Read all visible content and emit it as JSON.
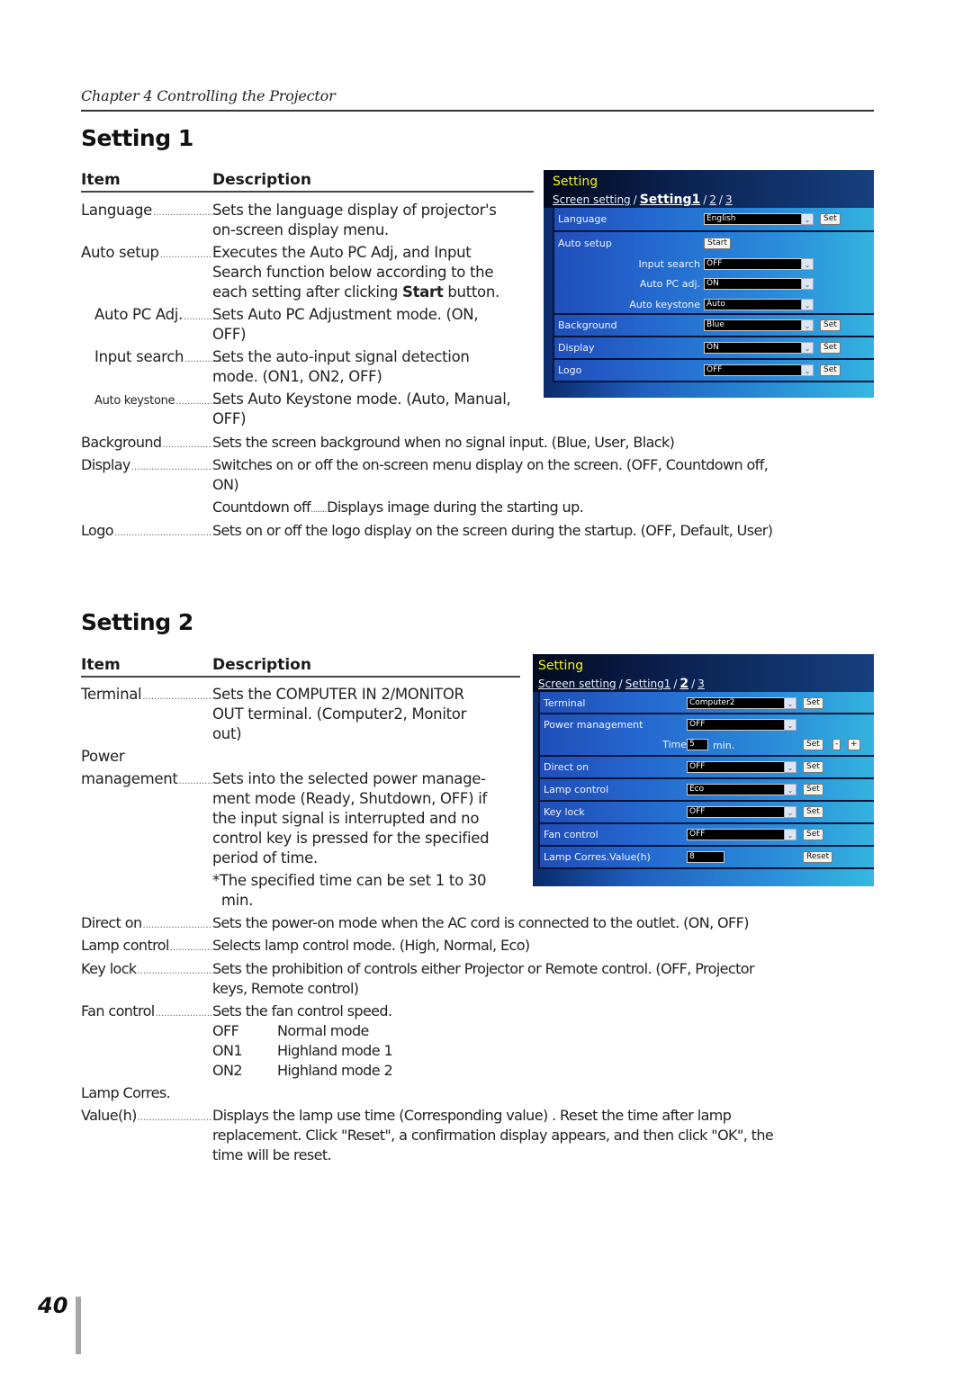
{
  "header": {
    "chapter": "Chapter 4 Controlling the Projector"
  },
  "section1": {
    "title": "Setting 1",
    "col_item": "Item",
    "col_desc": "Description",
    "entries": [
      {
        "item": "Language",
        "desc": [
          "Sets the language display of projector's",
          "on-screen display menu."
        ]
      },
      {
        "item": "Auto setup",
        "desc": [
          "Executes the Auto PC Adj, and Input",
          "Search function below according to the"
        ],
        "desc_last_pre": "each setting after clicking ",
        "desc_last_bold": "Start",
        "desc_last_post": " button."
      },
      {
        "item": "Auto PC Adj.",
        "desc": [
          "Sets Auto PC Adjustment mode. (ON,",
          "OFF)"
        ]
      },
      {
        "item": "Input search",
        "desc": [
          "Sets the auto-input signal detection",
          "mode. (ON1, ON2, OFF)"
        ]
      },
      {
        "item": "Auto keystone",
        "desc": [
          "Sets Auto Keystone mode. (Auto, Manual,",
          "OFF)"
        ]
      },
      {
        "item": "Background",
        "desc": [
          "Sets the screen background  when no signal input. (Blue, User, Black)"
        ]
      },
      {
        "item": "Display",
        "desc": [
          "Switches on or off the on-screen menu display on the screen. (OFF, Countdown off,",
          "ON)"
        ],
        "sub_item": "Countdown off",
        "sub_desc": "Displays image during the starting up."
      },
      {
        "item": "Logo",
        "desc": [
          "Sets on or off the logo display on the screen during the startup. (OFF, Default, User)"
        ]
      }
    ]
  },
  "section2": {
    "title": "Setting 2",
    "col_item": "Item",
    "col_desc": "Description",
    "entries": [
      {
        "item": "Terminal",
        "desc": [
          "Sets the COMPUTER IN 2/MONITOR",
          "OUT terminal. (Computer2, Monitor",
          "out)"
        ]
      },
      {
        "item_line1": "Power",
        "item": "management",
        "desc": [
          "Sets into the selected power manage-",
          "ment mode (Ready, Shutdown, OFF) if",
          "the input signal is interrupted and no",
          "control key is pressed for the specified",
          "period of time."
        ],
        "note": [
          "*The specified time can be set 1 to 30",
          "  min."
        ]
      },
      {
        "item": "Direct on",
        "desc": [
          "Sets the power-on mode when the AC cord is connected to the outlet. (ON, OFF)"
        ]
      },
      {
        "item": "Lamp control",
        "desc": [
          "Selects lamp control mode. (High, Normal, Eco)"
        ]
      },
      {
        "item": "Key lock",
        "desc": [
          "Sets the prohibition of controls either Projector or Remote control. (OFF, Projector",
          "keys, Remote control)"
        ]
      },
      {
        "item": "Fan control",
        "desc": [
          "Sets the fan control speed."
        ],
        "modes": [
          {
            "code": "OFF",
            "label": "Normal mode"
          },
          {
            "code": "ON1",
            "label": "Highland mode 1"
          },
          {
            "code": "ON2",
            "label": "Highland mode 2"
          }
        ]
      },
      {
        "item_line1": "Lamp Corres.",
        "item": "Value(h)",
        "desc": [
          "Displays the lamp use time (Corresponding value) . Reset the time after lamp",
          "replacement. Click \"Reset\", a confirmation display appears, and then click \"OK\", the",
          "time will be reset."
        ]
      }
    ]
  },
  "ui1": {
    "title": "Setting",
    "crumb_screen": "Screen setting",
    "crumb_setting1": "Setting1",
    "crumb_2": "2",
    "crumb_3": "3",
    "sep": "/",
    "language": {
      "label": "Language",
      "value": "English",
      "button": "Set"
    },
    "auto_setup": {
      "label": "Auto setup",
      "button": "Start"
    },
    "input_search": {
      "label": "Input search",
      "value": "OFF"
    },
    "auto_pc_adj": {
      "label": "Auto PC adj.",
      "value": "ON"
    },
    "auto_keystone": {
      "label": "Auto keystone",
      "value": "Auto"
    },
    "background": {
      "label": "Background",
      "value": "Blue",
      "button": "Set"
    },
    "display": {
      "label": "Display",
      "value": "ON",
      "button": "Set"
    },
    "logo": {
      "label": "Logo",
      "value": "OFF",
      "button": "Set"
    }
  },
  "ui2": {
    "title": "Setting",
    "crumb_screen": "Screen setting",
    "crumb_setting1": "Setting1",
    "crumb_2": "2",
    "crumb_3": "3",
    "sep": "/",
    "terminal": {
      "label": "Terminal",
      "value": "Computer2",
      "button": "Set"
    },
    "power_management": {
      "label": "Power management",
      "value": "OFF",
      "time_label": "Time",
      "time_value": "5",
      "time_unit": "min.",
      "button": "Set",
      "minus": "-",
      "plus": "+"
    },
    "direct_on": {
      "label": "Direct on",
      "value": "OFF",
      "button": "Set"
    },
    "lamp_control": {
      "label": "Lamp control",
      "value": "Eco",
      "button": "Set"
    },
    "key_lock": {
      "label": "Key lock",
      "value": "OFF",
      "button": "Set"
    },
    "fan_control": {
      "label": "Fan control",
      "value": "OFF",
      "button": "Set"
    },
    "lamp_corres": {
      "label": "Lamp Corres.Value(h)",
      "value": "8",
      "button": "Reset"
    }
  },
  "footer": {
    "page_number": "40"
  },
  "icons": {
    "dropdown_arrow": "⌄"
  }
}
